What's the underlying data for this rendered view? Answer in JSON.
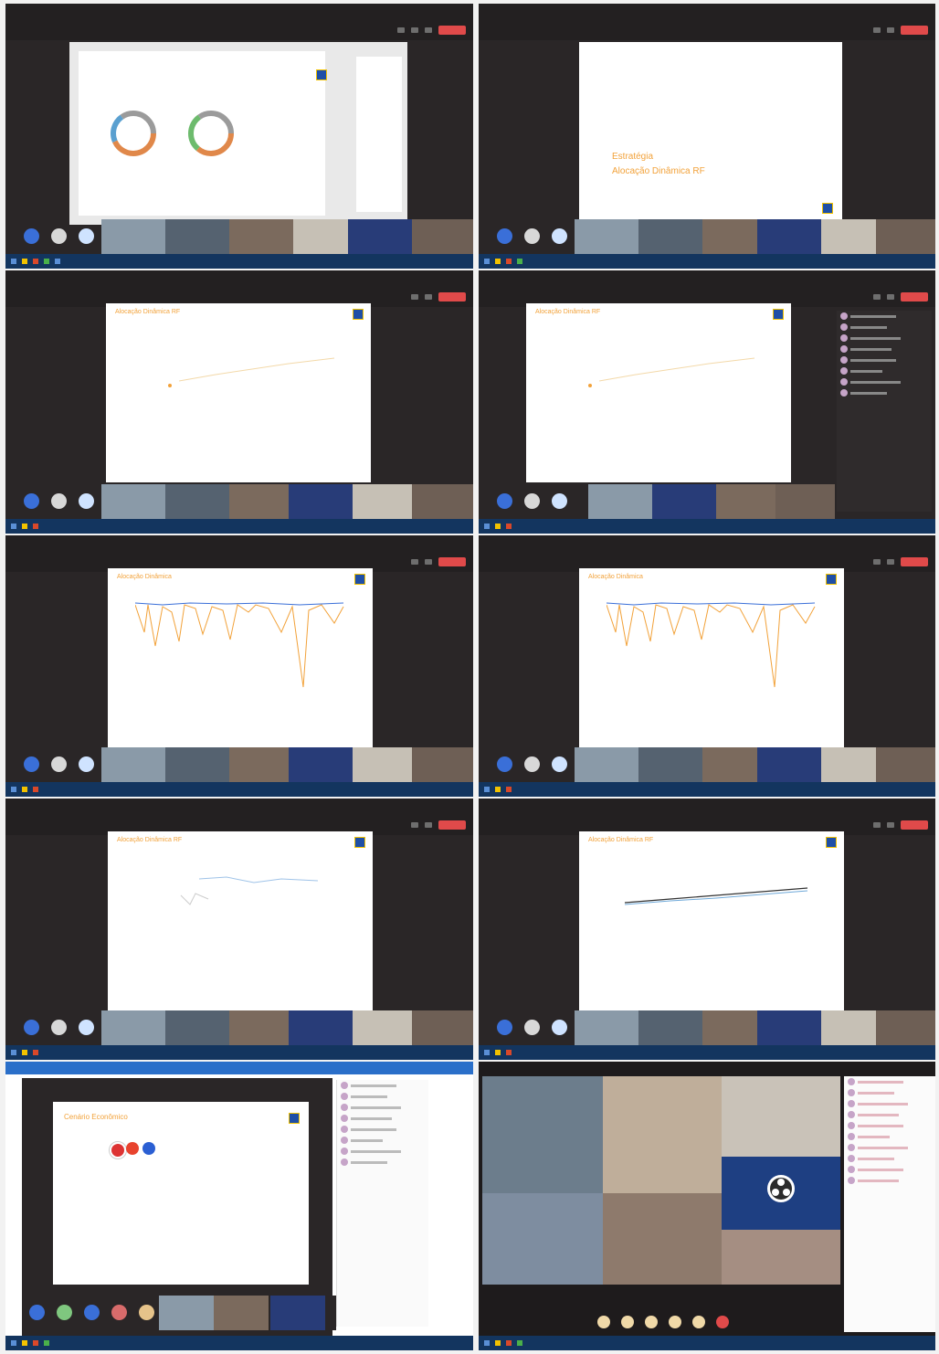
{
  "meetings": [
    {
      "slide_title": "",
      "slide_subtitle": ""
    },
    {
      "slide_title": "Estratégia",
      "slide_title2": "Alocação Dinâmica RF",
      "slide_subtitle": ""
    },
    {
      "slide_title": "Alocação Dinâmica RF",
      "slide_subtitle": ""
    },
    {
      "slide_title": "Alocação Dinâmica RF",
      "slide_subtitle": ""
    },
    {
      "slide_title": "Alocação Dinâmica",
      "slide_subtitle": ""
    },
    {
      "slide_title": "Alocação Dinâmica",
      "slide_subtitle": ""
    },
    {
      "slide_title": "Alocação Dinâmica RF",
      "slide_subtitle": ""
    },
    {
      "slide_title": "Alocação Dinâmica RF",
      "slide_subtitle": ""
    },
    {
      "slide_title": "Cenário Econômico",
      "slide_subtitle": ""
    }
  ],
  "colors": {
    "accent": "#f2a23a",
    "leave": "#e04a4a",
    "taskbar": "#13355f",
    "brand": "#1f4fa6"
  },
  "icons": [
    "camera-icon",
    "mic-icon",
    "share-icon",
    "leave-icon",
    "bb-logo-icon"
  ]
}
